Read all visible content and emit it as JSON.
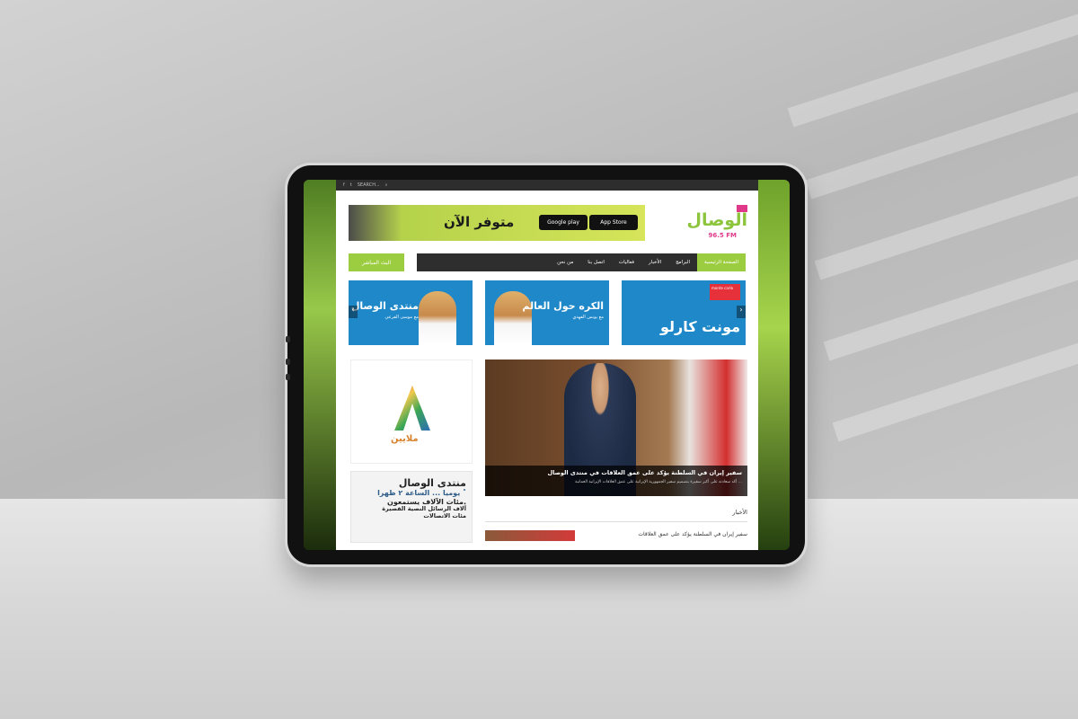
{
  "topbar": {
    "search_label": "SEARCH..."
  },
  "header": {
    "logo_name": "الوصال",
    "logo_freq": "96.5 FM",
    "banner_slogan": "متوفر الآن",
    "store_google": "Google play",
    "store_apple": "App Store"
  },
  "nav": {
    "live_label": "البث المباشر",
    "items": [
      "الصفحة الرئيسية",
      "البرامج",
      "الأخبار",
      "فعاليات",
      "اتصل بنا",
      "من نحن"
    ]
  },
  "promos": [
    {
      "title": "منتدى الوصال",
      "sub": "مع موسى الفرعي"
    },
    {
      "title": "الكره حول العالم",
      "sub": "مع يونس الفهدي"
    },
    {
      "title": "مونت كارلو",
      "brand": "monte carlo"
    }
  ],
  "sidebar": {
    "ad1_text": "ملايين",
    "ad2_lines": [
      "منتدى الوصال",
      "يوميا ... الساعة ٢ ظهرا ˚",
      "مئات الآلاف يستمعون.",
      "آلاف الرسائل النصية القصيرة",
      "مئات الاتصالات"
    ]
  },
  "feature": {
    "title": "سفير إيران في السلطنة يؤكد على عمق العلاقات في منتدى الوصال",
    "desc": "أكد سعادته على أكبر سفيرة بتصميم سفير الجمهورية الإيرانية على عمق العلاقات الإيرانية العمانية ..."
  },
  "news": {
    "header": "الأخبار",
    "first_title": "سفير إيران في السلطنة يؤكد على عمق العلاقات"
  }
}
